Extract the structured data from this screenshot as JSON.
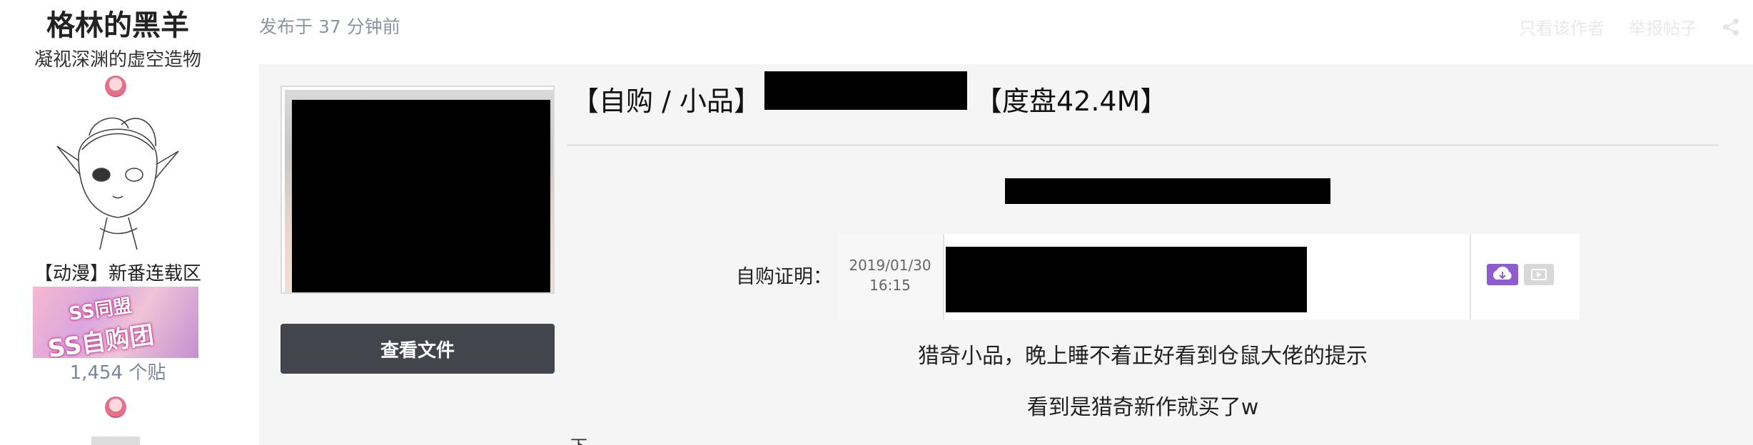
{
  "user": {
    "name": "格林的黑羊",
    "title": "凝视深渊的虚空造物",
    "group": "【动漫】新番连载区",
    "banner_text_top": "SS同盟",
    "banner_text_bottom": "SS自购团",
    "post_count": "1,454 个贴",
    "rank_icon": "rank-badge-icon"
  },
  "header": {
    "post_time": "发布于 37 分钟前",
    "only_author": "只看该作者",
    "report": "举报帖子",
    "share_icon": "share-icon"
  },
  "post": {
    "title_prefix": "【自购 / 小品】",
    "title_suffix": "【度盘42.4M】",
    "view_files_label": "查看文件",
    "proof_label": "自购证明：",
    "proof_date": "2019/01/30",
    "proof_time": "16:15",
    "line1": "猎奇小品，晚上睡不着正好看到仓鼠大佬的提示",
    "line2": "看到是猎奇新作就买了w",
    "line3_partial": "下载"
  },
  "colors": {
    "panel_bg": "#f5f5f5",
    "button_bg": "#42464c",
    "muted_text": "#8b95a3",
    "cloud_accent": "#8e5bd1"
  }
}
